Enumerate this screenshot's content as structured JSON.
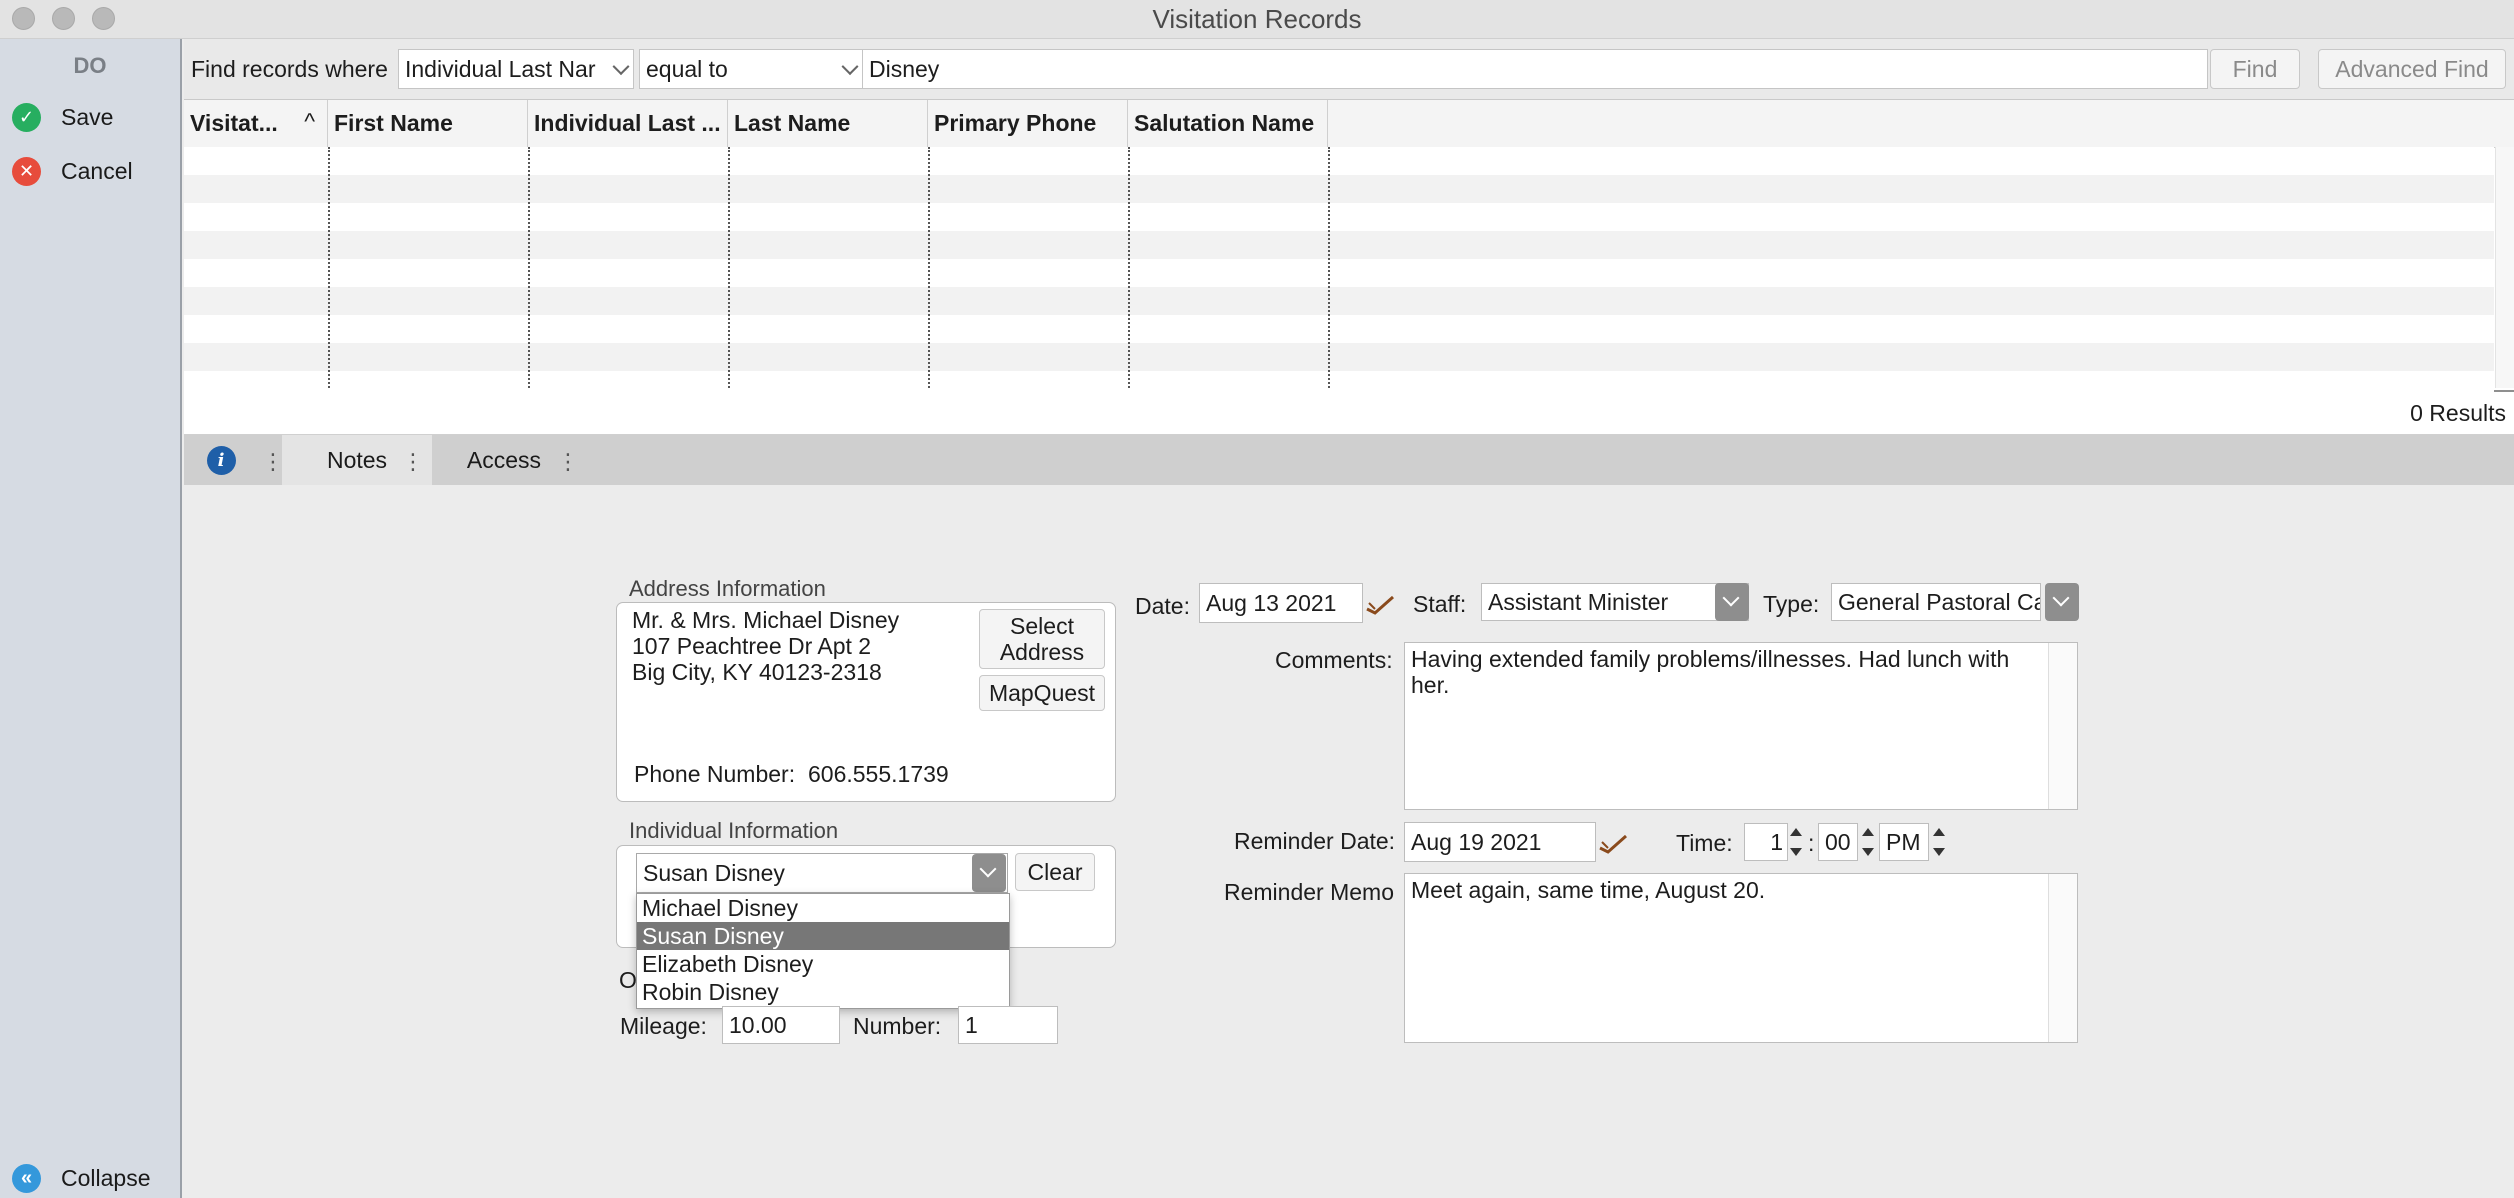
{
  "window": {
    "title": "Visitation Records"
  },
  "sidebar": {
    "heading": "DO",
    "save_label": "Save",
    "cancel_label": "Cancel",
    "collapse_label": "Collapse"
  },
  "find": {
    "prefix": "Find records where",
    "field_value": "Individual Last Nar",
    "operator_value": "equal to",
    "search_value": "Disney",
    "find_label": "Find",
    "advanced_label": "Advanced Find"
  },
  "table": {
    "columns": [
      "Visitat...",
      "First Name",
      "Individual Last ...",
      "Last Name",
      "Primary Phone",
      "Salutation Name"
    ],
    "sort_glyph": "^",
    "rows": []
  },
  "results": "0 Results",
  "tabs": [
    {
      "label": "Notes",
      "selected": true
    },
    {
      "label": "Access",
      "selected": false
    }
  ],
  "address": {
    "group_label": "Address Information",
    "line1": "Mr. & Mrs. Michael Disney",
    "line2": "107 Peachtree Dr  Apt 2",
    "line3": "Big City, KY 40123-2318",
    "select_label_1": "Select",
    "select_label_2": "Address",
    "mapquest_label": "MapQuest",
    "phone_label": "Phone Number:",
    "phone_value": "606.555.1739"
  },
  "individual": {
    "group_label": "Individual Information",
    "selected": "Susan Disney",
    "clear_label": "Clear",
    "options": [
      "Michael Disney",
      "Susan Disney",
      "Elizabeth Disney",
      "Robin Disney"
    ],
    "obscured_label": "O"
  },
  "mileage": {
    "label": "Mileage:",
    "value": "10.00"
  },
  "number": {
    "label": "Number:",
    "value": "1"
  },
  "visit": {
    "date_label": "Date:",
    "date_value": "Aug 13 2021",
    "staff_label": "Staff:",
    "staff_value": "Assistant Minister",
    "type_label": "Type:",
    "type_value": "General Pastoral Ca",
    "comments_label": "Comments:",
    "comments_value": "Having extended family problems/illnesses. Had lunch with her.",
    "reminder_date_label": "Reminder Date:",
    "reminder_date_value": "Aug 19 2021",
    "time_label": "Time:",
    "time_hour": "1",
    "time_sep": ":",
    "time_minute": "00",
    "time_ampm": "PM",
    "reminder_memo_label": "Reminder Memo",
    "reminder_memo_value": "Meet again, same time, August 20."
  },
  "colors": {
    "save_icon": "#27ae60",
    "cancel_icon": "#e74c3c",
    "collapse_icon": "#3498db",
    "info_icon": "#1f5fa8",
    "selection": "#777777"
  }
}
